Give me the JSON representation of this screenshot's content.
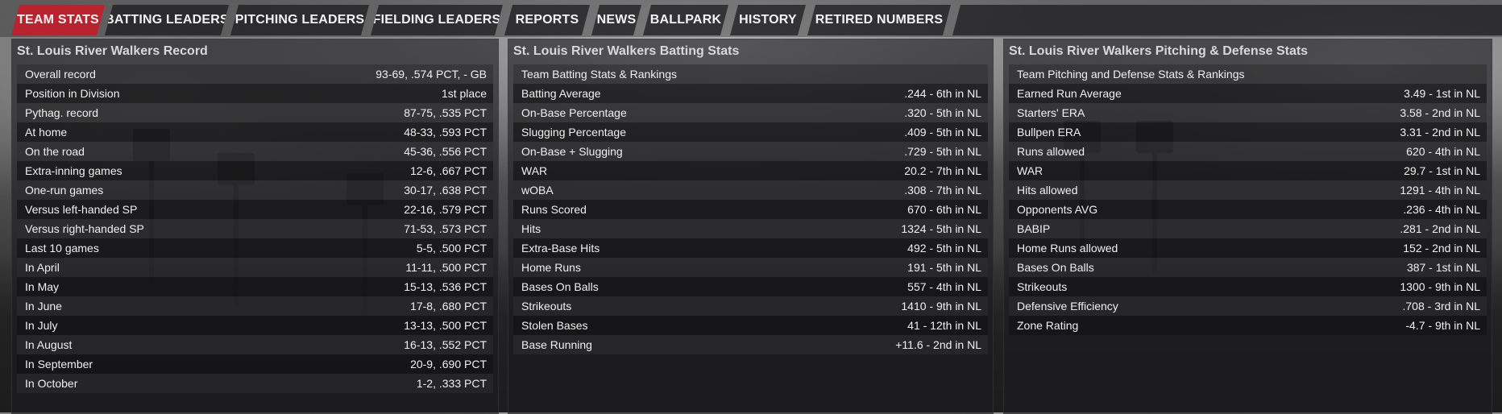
{
  "tabs": [
    {
      "label": "TEAM STATS",
      "active": true
    },
    {
      "label": "BATTING LEADERS"
    },
    {
      "label": "PITCHING LEADERS"
    },
    {
      "label": "FIELDING LEADERS"
    },
    {
      "label": "REPORTS"
    },
    {
      "label": "NEWS"
    },
    {
      "label": "BALLPARK"
    },
    {
      "label": "HISTORY"
    },
    {
      "label": "RETIRED NUMBERS"
    }
  ],
  "colors": {
    "active_tab": "#b8232f",
    "panel": "#1c1c1e"
  },
  "record": {
    "title": "St. Louis River Walkers Record",
    "rows": [
      {
        "label": "Overall record",
        "value": "93-69, .574 PCT, - GB"
      },
      {
        "label": "Position in Division",
        "value": "1st place"
      },
      {
        "label": "Pythag. record",
        "value": "87-75, .535 PCT"
      },
      {
        "label": "At home",
        "value": "48-33, .593 PCT"
      },
      {
        "label": "On the road",
        "value": "45-36, .556 PCT"
      },
      {
        "label": "Extra-inning games",
        "value": "12-6, .667 PCT"
      },
      {
        "label": "One-run games",
        "value": "30-17, .638 PCT"
      },
      {
        "label": "Versus left-handed SP",
        "value": "22-16, .579 PCT"
      },
      {
        "label": "Versus right-handed SP",
        "value": "71-53, .573 PCT"
      },
      {
        "label": "Last 10 games",
        "value": "5-5, .500 PCT"
      },
      {
        "label": "In April",
        "value": "11-11, .500 PCT"
      },
      {
        "label": "In May",
        "value": "15-13, .536 PCT"
      },
      {
        "label": "In June",
        "value": "17-8, .680 PCT"
      },
      {
        "label": "In July",
        "value": "13-13, .500 PCT"
      },
      {
        "label": "In August",
        "value": "16-13, .552 PCT"
      },
      {
        "label": "In September",
        "value": "20-9, .690 PCT"
      },
      {
        "label": "In October",
        "value": "1-2, .333 PCT"
      }
    ]
  },
  "batting": {
    "title": "St. Louis River Walkers Batting Stats",
    "header": "Team Batting Stats & Rankings",
    "rows": [
      {
        "label": "Batting Average",
        "value": ".244 - 6th  in NL"
      },
      {
        "label": "On-Base Percentage",
        "value": ".320 - 5th  in NL"
      },
      {
        "label": "Slugging Percentage",
        "value": ".409 - 5th  in NL"
      },
      {
        "label": "On-Base + Slugging",
        "value": ".729 - 5th  in NL"
      },
      {
        "label": "WAR",
        "value": "20.2 - 7th  in NL"
      },
      {
        "label": "wOBA",
        "value": ".308 - 7th  in NL"
      },
      {
        "label": "Runs Scored",
        "value": "670 - 6th  in NL"
      },
      {
        "label": "Hits",
        "value": "1324 - 5th  in NL"
      },
      {
        "label": "Extra-Base Hits",
        "value": "492 - 5th  in NL"
      },
      {
        "label": "Home Runs",
        "value": "191 - 5th  in NL"
      },
      {
        "label": "Bases On Balls",
        "value": "557 - 4th  in NL"
      },
      {
        "label": "Strikeouts",
        "value": "1410 - 9th  in NL"
      },
      {
        "label": "Stolen Bases",
        "value": "41 - 12th  in NL"
      },
      {
        "label": "Base Running",
        "value": "+11.6 - 2nd  in NL"
      }
    ]
  },
  "pitching": {
    "title": "St. Louis River Walkers Pitching & Defense Stats",
    "header": "Team Pitching and Defense Stats & Rankings",
    "rows": [
      {
        "label": "Earned Run Average",
        "value": "3.49 - 1st  in NL"
      },
      {
        "label": "Starters' ERA",
        "value": "3.58 - 2nd  in NL"
      },
      {
        "label": "Bullpen ERA",
        "value": "3.31 - 2nd  in NL"
      },
      {
        "label": "Runs allowed",
        "value": "620 - 4th  in NL"
      },
      {
        "label": "WAR",
        "value": "29.7 - 1st  in NL"
      },
      {
        "label": "Hits allowed",
        "value": "1291 - 4th  in NL"
      },
      {
        "label": "Opponents AVG",
        "value": ".236 - 4th  in NL"
      },
      {
        "label": "BABIP",
        "value": ".281 - 2nd  in NL"
      },
      {
        "label": "Home Runs allowed",
        "value": "152 - 2nd  in NL"
      },
      {
        "label": "Bases On Balls",
        "value": "387 - 1st  in NL"
      },
      {
        "label": "Strikeouts",
        "value": "1300 - 9th  in NL"
      },
      {
        "label": "Defensive Efficiency",
        "value": ".708 - 3rd  in NL"
      },
      {
        "label": "Zone Rating",
        "value": "-4.7 - 9th  in NL"
      }
    ]
  }
}
